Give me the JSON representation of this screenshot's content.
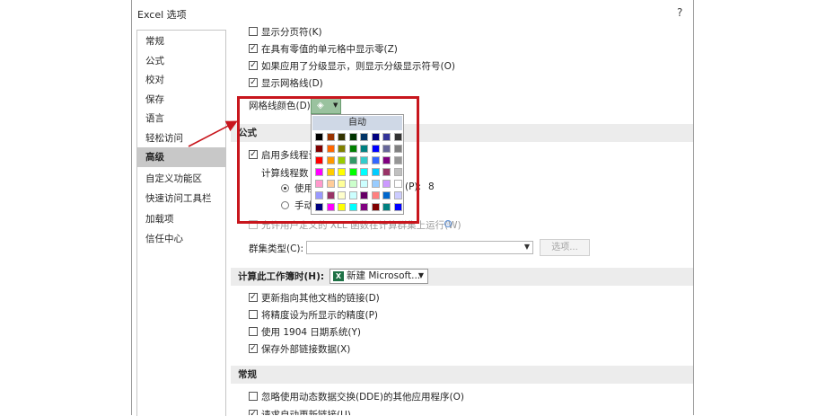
{
  "window": {
    "title": "Excel 选项",
    "help": "?"
  },
  "nav": {
    "items": [
      "常规",
      "公式",
      "校对",
      "保存",
      "语言",
      "轻松访问",
      "高级",
      "自定义功能区",
      "快速访问工具栏",
      "加载项",
      "信任中心"
    ],
    "selected": "高级"
  },
  "options": {
    "show_page_breaks": "显示分页符(K)",
    "show_zeros": "在具有零值的单元格中显示零(Z)",
    "show_outline": "如果应用了分级显示，则显示分级显示符号(O)",
    "show_gridlines": "显示网格线(D)",
    "gridline_color_label": "网格线颜色(D)"
  },
  "palette": {
    "auto_label": "自动"
  },
  "formulas": {
    "section": "公式",
    "multithread": "启用多线程计",
    "threads_label": "计算线程数",
    "radio_use": "使用",
    "radio_use_tail": "(P):",
    "threads_value": "8",
    "radio_manual": "手动",
    "xll_clusters": "允许用户定义的 XLL 函数在计算群集上运行(W)",
    "cluster_type_label": "群集类型(C):",
    "options_button": "选项..."
  },
  "workbook": {
    "section": "计算此工作簿时(H):",
    "selected": "新建 Microsoft...",
    "update_links": "更新指向其他文档的链接(D)",
    "precision": "将精度设为所显示的精度(P)",
    "date_1904": "使用 1904 日期系统(Y)",
    "save_external": "保存外部链接数据(X)"
  },
  "general": {
    "section": "常规",
    "ignore_dde": "忽略使用动态数据交换(DDE)的其他应用程序(O)",
    "ask_update": "请求自动更新链接(U)"
  },
  "colors": {
    "accent_button": "#9ac29f",
    "highlight": "#c8161d",
    "nav_selected": "#c8c8c8",
    "excel_green": "#1e7145"
  }
}
